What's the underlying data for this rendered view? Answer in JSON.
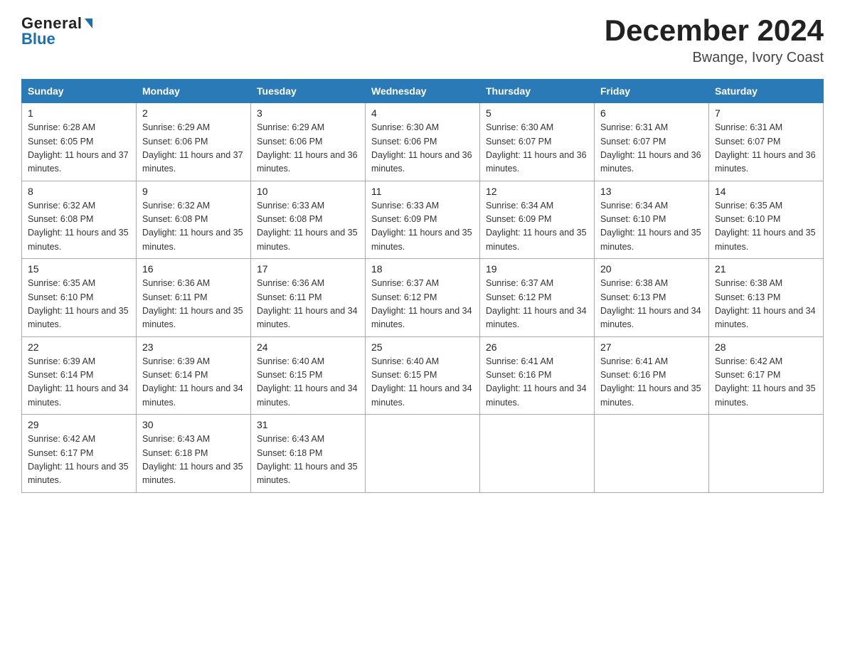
{
  "logo": {
    "top": "General",
    "bottom": "Blue"
  },
  "title": "December 2024",
  "subtitle": "Bwange, Ivory Coast",
  "days_of_week": [
    "Sunday",
    "Monday",
    "Tuesday",
    "Wednesday",
    "Thursday",
    "Friday",
    "Saturday"
  ],
  "weeks": [
    [
      {
        "date": "1",
        "sunrise": "6:28 AM",
        "sunset": "6:05 PM",
        "daylight": "11 hours and 37 minutes."
      },
      {
        "date": "2",
        "sunrise": "6:29 AM",
        "sunset": "6:06 PM",
        "daylight": "11 hours and 37 minutes."
      },
      {
        "date": "3",
        "sunrise": "6:29 AM",
        "sunset": "6:06 PM",
        "daylight": "11 hours and 36 minutes."
      },
      {
        "date": "4",
        "sunrise": "6:30 AM",
        "sunset": "6:06 PM",
        "daylight": "11 hours and 36 minutes."
      },
      {
        "date": "5",
        "sunrise": "6:30 AM",
        "sunset": "6:07 PM",
        "daylight": "11 hours and 36 minutes."
      },
      {
        "date": "6",
        "sunrise": "6:31 AM",
        "sunset": "6:07 PM",
        "daylight": "11 hours and 36 minutes."
      },
      {
        "date": "7",
        "sunrise": "6:31 AM",
        "sunset": "6:07 PM",
        "daylight": "11 hours and 36 minutes."
      }
    ],
    [
      {
        "date": "8",
        "sunrise": "6:32 AM",
        "sunset": "6:08 PM",
        "daylight": "11 hours and 35 minutes."
      },
      {
        "date": "9",
        "sunrise": "6:32 AM",
        "sunset": "6:08 PM",
        "daylight": "11 hours and 35 minutes."
      },
      {
        "date": "10",
        "sunrise": "6:33 AM",
        "sunset": "6:08 PM",
        "daylight": "11 hours and 35 minutes."
      },
      {
        "date": "11",
        "sunrise": "6:33 AM",
        "sunset": "6:09 PM",
        "daylight": "11 hours and 35 minutes."
      },
      {
        "date": "12",
        "sunrise": "6:34 AM",
        "sunset": "6:09 PM",
        "daylight": "11 hours and 35 minutes."
      },
      {
        "date": "13",
        "sunrise": "6:34 AM",
        "sunset": "6:10 PM",
        "daylight": "11 hours and 35 minutes."
      },
      {
        "date": "14",
        "sunrise": "6:35 AM",
        "sunset": "6:10 PM",
        "daylight": "11 hours and 35 minutes."
      }
    ],
    [
      {
        "date": "15",
        "sunrise": "6:35 AM",
        "sunset": "6:10 PM",
        "daylight": "11 hours and 35 minutes."
      },
      {
        "date": "16",
        "sunrise": "6:36 AM",
        "sunset": "6:11 PM",
        "daylight": "11 hours and 35 minutes."
      },
      {
        "date": "17",
        "sunrise": "6:36 AM",
        "sunset": "6:11 PM",
        "daylight": "11 hours and 34 minutes."
      },
      {
        "date": "18",
        "sunrise": "6:37 AM",
        "sunset": "6:12 PM",
        "daylight": "11 hours and 34 minutes."
      },
      {
        "date": "19",
        "sunrise": "6:37 AM",
        "sunset": "6:12 PM",
        "daylight": "11 hours and 34 minutes."
      },
      {
        "date": "20",
        "sunrise": "6:38 AM",
        "sunset": "6:13 PM",
        "daylight": "11 hours and 34 minutes."
      },
      {
        "date": "21",
        "sunrise": "6:38 AM",
        "sunset": "6:13 PM",
        "daylight": "11 hours and 34 minutes."
      }
    ],
    [
      {
        "date": "22",
        "sunrise": "6:39 AM",
        "sunset": "6:14 PM",
        "daylight": "11 hours and 34 minutes."
      },
      {
        "date": "23",
        "sunrise": "6:39 AM",
        "sunset": "6:14 PM",
        "daylight": "11 hours and 34 minutes."
      },
      {
        "date": "24",
        "sunrise": "6:40 AM",
        "sunset": "6:15 PM",
        "daylight": "11 hours and 34 minutes."
      },
      {
        "date": "25",
        "sunrise": "6:40 AM",
        "sunset": "6:15 PM",
        "daylight": "11 hours and 34 minutes."
      },
      {
        "date": "26",
        "sunrise": "6:41 AM",
        "sunset": "6:16 PM",
        "daylight": "11 hours and 34 minutes."
      },
      {
        "date": "27",
        "sunrise": "6:41 AM",
        "sunset": "6:16 PM",
        "daylight": "11 hours and 35 minutes."
      },
      {
        "date": "28",
        "sunrise": "6:42 AM",
        "sunset": "6:17 PM",
        "daylight": "11 hours and 35 minutes."
      }
    ],
    [
      {
        "date": "29",
        "sunrise": "6:42 AM",
        "sunset": "6:17 PM",
        "daylight": "11 hours and 35 minutes."
      },
      {
        "date": "30",
        "sunrise": "6:43 AM",
        "sunset": "6:18 PM",
        "daylight": "11 hours and 35 minutes."
      },
      {
        "date": "31",
        "sunrise": "6:43 AM",
        "sunset": "6:18 PM",
        "daylight": "11 hours and 35 minutes."
      },
      null,
      null,
      null,
      null
    ]
  ]
}
